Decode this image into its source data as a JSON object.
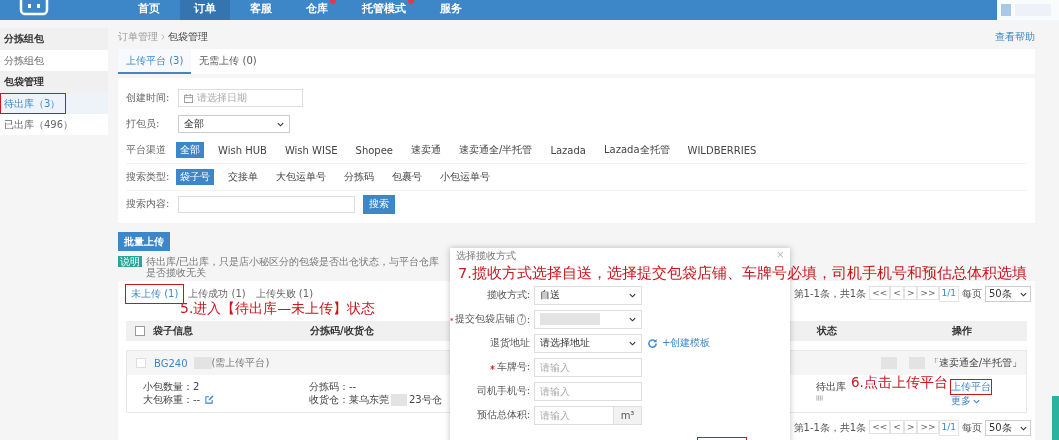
{
  "nav": {
    "items": [
      {
        "label": "首页",
        "selected": false,
        "badge": false
      },
      {
        "label": "订单",
        "selected": true,
        "badge": false
      },
      {
        "label": "客服",
        "selected": false,
        "badge": false
      },
      {
        "label": "仓库",
        "selected": false,
        "badge": true
      },
      {
        "label": "托管模式",
        "selected": false,
        "badge": true
      },
      {
        "label": "服务",
        "selected": false,
        "badge": false
      }
    ]
  },
  "sidebar": {
    "groups": [
      {
        "title": "分拣组包",
        "items": [
          {
            "label": "分拣组包",
            "selected": false,
            "highlighted": false
          }
        ]
      },
      {
        "title": "包袋管理",
        "items": [
          {
            "label": "待出库（3）",
            "selected": true,
            "highlighted": true
          },
          {
            "label": "已出库（496）",
            "selected": false,
            "highlighted": false
          }
        ]
      }
    ]
  },
  "breadcrumb": [
    "订单管理",
    "包袋管理"
  ],
  "help_link": "查看帮助",
  "tabs": [
    {
      "label": "上传平台 (3)",
      "selected": true
    },
    {
      "label": "无需上传 (0)",
      "selected": false
    }
  ],
  "filters": {
    "created_time": {
      "label": "创建时间:",
      "placeholder": "请选择日期"
    },
    "packer": {
      "label": "打包员:",
      "value": "全部"
    },
    "channel": {
      "label": "平台渠道",
      "options": [
        {
          "label": "全部",
          "selected": true
        },
        {
          "label": "Wish HUB",
          "selected": false
        },
        {
          "label": "Wish WISE",
          "selected": false
        },
        {
          "label": "Shopee",
          "selected": false
        },
        {
          "label": "速卖通",
          "selected": false
        },
        {
          "label": "速卖通全/半托管",
          "selected": false
        },
        {
          "label": "Lazada",
          "selected": false
        },
        {
          "label": "Lazada全托管",
          "selected": false
        },
        {
          "label": "WILDBERRIES",
          "selected": false
        }
      ]
    },
    "search_type": {
      "label": "搜索类型:",
      "options": [
        {
          "label": "袋子号",
          "selected": true
        },
        {
          "label": "交接单",
          "selected": false
        },
        {
          "label": "大包运单号",
          "selected": false
        },
        {
          "label": "分拣码",
          "selected": false
        },
        {
          "label": "包裹号",
          "selected": false
        },
        {
          "label": "小包运单号",
          "selected": false
        }
      ]
    },
    "search_content": {
      "label": "搜索内容:",
      "button": "搜索"
    }
  },
  "batch_button": "批量上传",
  "note": {
    "badge": "说明",
    "text": "待出库/已出库，只是店小秘区分的包袋是否出仓状态，与平台仓库是否揽收无关"
  },
  "subtabs": [
    {
      "label": "未上传 (1)",
      "selected": true,
      "highlighted": true
    },
    {
      "label": "上传成功 (1)",
      "selected": false,
      "highlighted": false
    },
    {
      "label": "上传失败 (1)",
      "selected": false,
      "highlighted": false
    }
  ],
  "pagers": [
    {
      "range": "第1-1条，共1条",
      "buttons": [
        "<<",
        "<",
        ">",
        ">>"
      ],
      "page": "1/1",
      "per_page_label": "每页",
      "per_page": "50条"
    },
    {
      "range": "第1-1条，共1条",
      "buttons": [
        "<<",
        "<",
        ">",
        ">>"
      ],
      "page": "1/1",
      "per_page_label": "每页",
      "per_page": "50条"
    }
  ],
  "table": {
    "columns": [
      "袋子信息",
      "分拣码/收货仓",
      "状态",
      "操作"
    ],
    "all_checked": false,
    "rows": [
      {
        "checked": false,
        "bag_id": "BG240",
        "tag": "(需上传平台)",
        "platform": "「速卖通全/半托管」",
        "small_count": "小包数量：2",
        "weight": "大包称重：--",
        "sort_code": "分拣码：--",
        "warehouse_prefix": "收货仓：莱乌东莞",
        "warehouse_suffix": "23号仓",
        "status": "待出库",
        "action": "上传平台",
        "action_highlighted": true,
        "more": "更多"
      }
    ]
  },
  "modal": {
    "title": "选择揽收方式",
    "close": "×",
    "fields": [
      {
        "kind": "select",
        "label": "揽收方式:",
        "required": false,
        "value": "自送"
      },
      {
        "kind": "select",
        "label": "提交包袋店铺",
        "required": true,
        "help": "?",
        "label_end": ":"
      },
      {
        "kind": "select",
        "label": "退货地址",
        "required": false,
        "value": "请选择地址",
        "link": "+创建模板"
      },
      {
        "kind": "input",
        "label": "车牌号:",
        "required": true,
        "placeholder": "请输入"
      },
      {
        "kind": "input",
        "label": "司机手机号:",
        "required": false,
        "placeholder": "请输入"
      },
      {
        "kind": "input",
        "label": "预估总体积:",
        "required": false,
        "placeholder": "请输入",
        "addon": "m³"
      }
    ]
  },
  "annotations": [
    {
      "text": "5.进入【待出库—未上传】状态"
    },
    {
      "text": "6.点击上传平台"
    },
    {
      "text": "7.揽收方式选择自送，选择提交包袋店铺、车牌号必填，司机手机号和预估总体积选填"
    }
  ]
}
